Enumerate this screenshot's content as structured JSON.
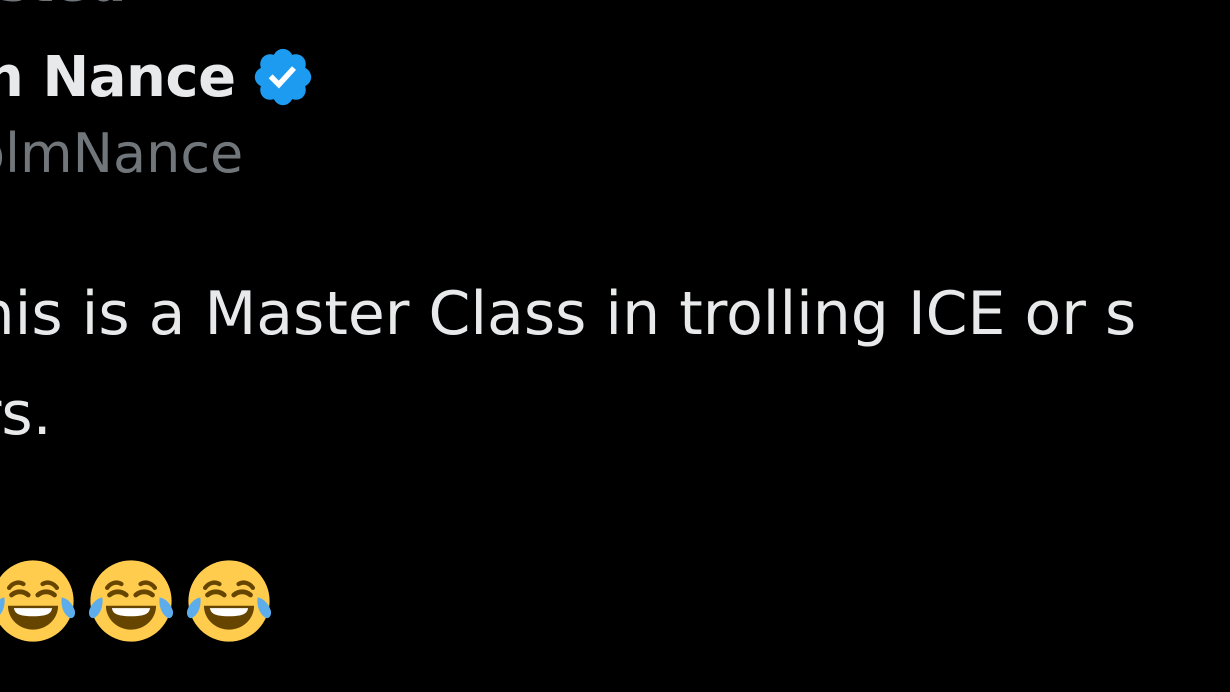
{
  "header": {
    "context_line_fragment": "sted"
  },
  "author": {
    "display_name_fragment": "n Nance",
    "verified_icon": "verified-badge-icon",
    "handle_fragment": "olmNance"
  },
  "post": {
    "line1": "This is a Master Class in trolling ICE or s",
    "line2": "ors."
  },
  "reactions": {
    "emoji_icon": "face-with-tears-of-joy-icon",
    "count_shown": 3
  },
  "colors": {
    "background": "#000000",
    "primary_text": "#e7e9ea",
    "secondary_text": "#71767b",
    "verified_blue": "#1d9bf0"
  }
}
